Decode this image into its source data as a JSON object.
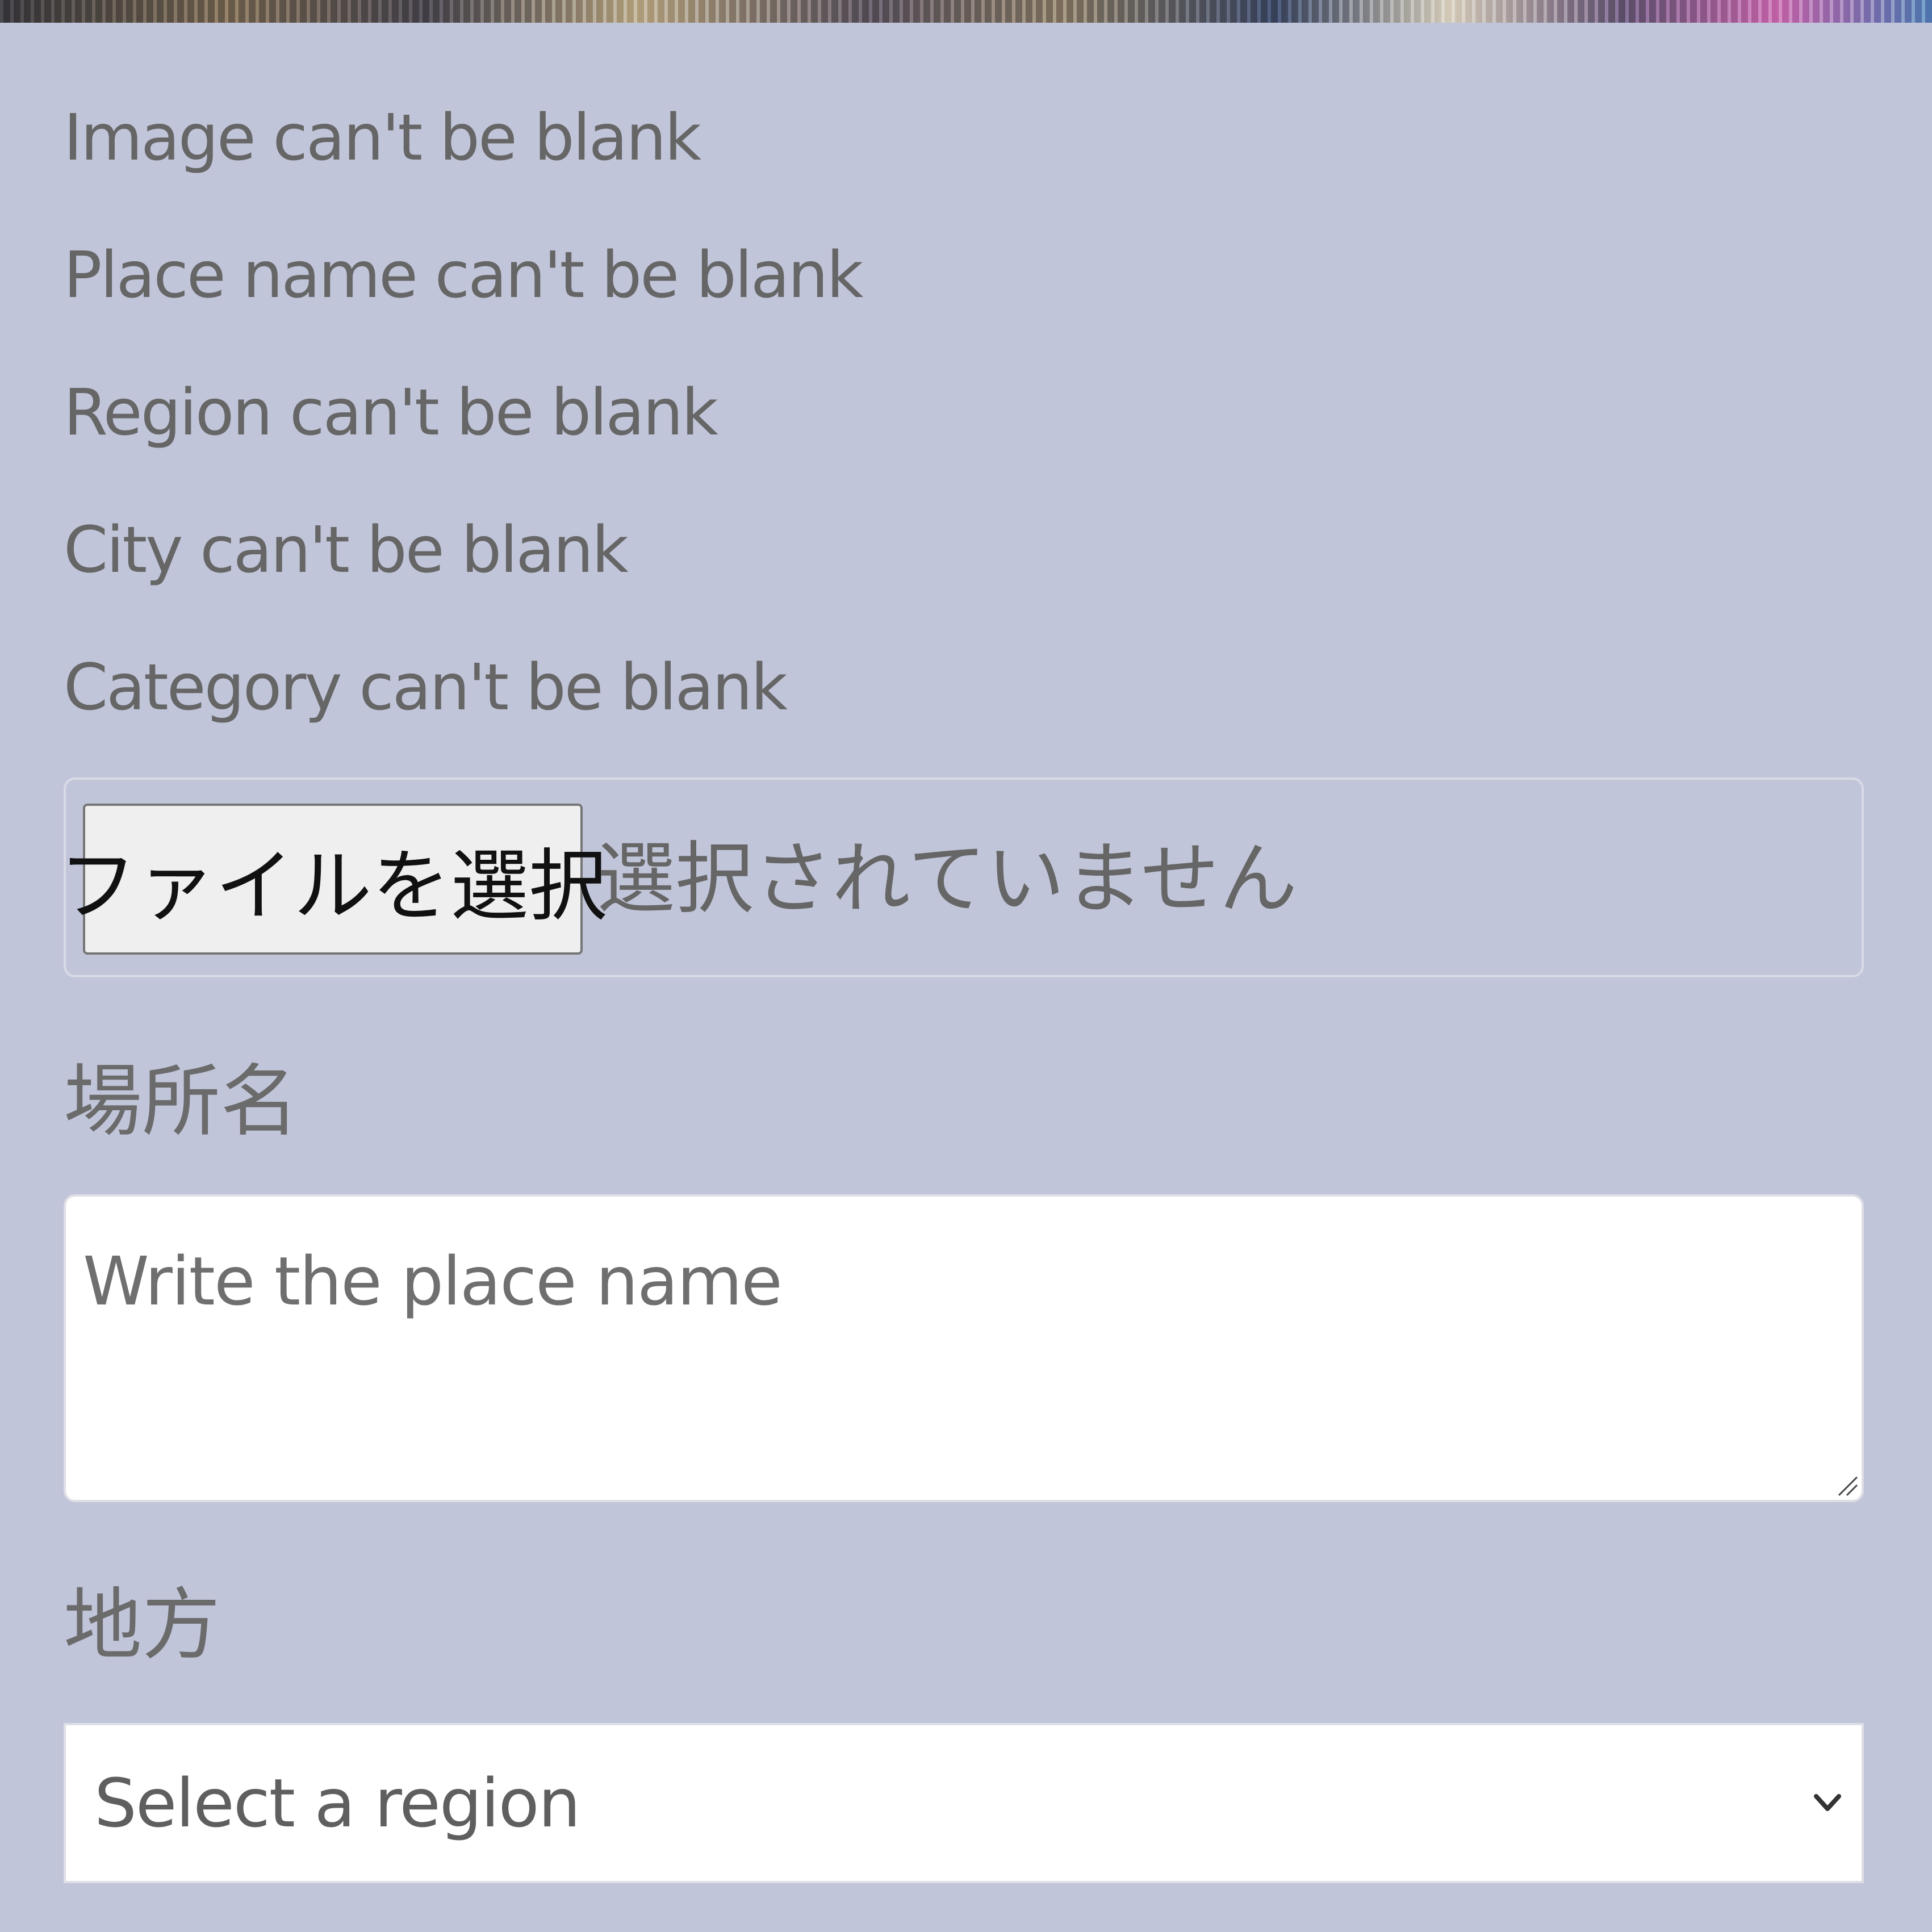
{
  "errors": [
    "Image can't be blank",
    "Place name can't be blank",
    "Region can't be blank",
    "City can't be blank",
    "Category can't be blank"
  ],
  "file_input": {
    "button_label": "ファイルを選択",
    "status": "選択されていません"
  },
  "place_name": {
    "label": "場所名",
    "placeholder": "Write the place name"
  },
  "region": {
    "label": "地方",
    "selected": "Select a region"
  },
  "icons": {
    "resize": "resize-handle-icon",
    "select": "chevron-down-icon"
  }
}
